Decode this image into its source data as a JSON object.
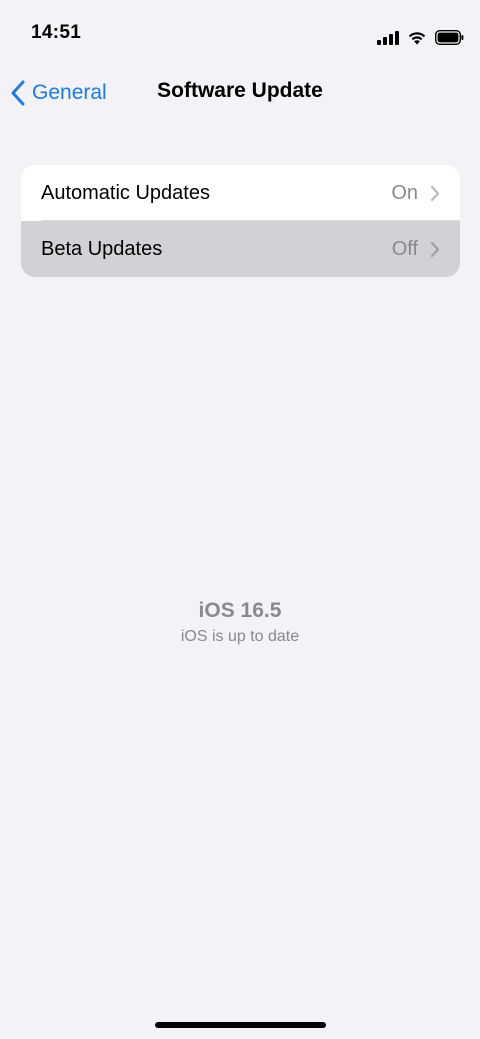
{
  "status_bar": {
    "time": "14:51"
  },
  "nav": {
    "back_label": "General",
    "title": "Software Update"
  },
  "settings": {
    "rows": [
      {
        "label": "Automatic Updates",
        "value": "On"
      },
      {
        "label": "Beta Updates",
        "value": "Off"
      }
    ]
  },
  "version": {
    "title": "iOS 16.5",
    "status": "iOS is up to date"
  },
  "colors": {
    "accent": "#1C7CE5",
    "background": "#F2F2F7",
    "secondary_text": "#8A8A8E",
    "highlight": "#D1D1D6"
  }
}
